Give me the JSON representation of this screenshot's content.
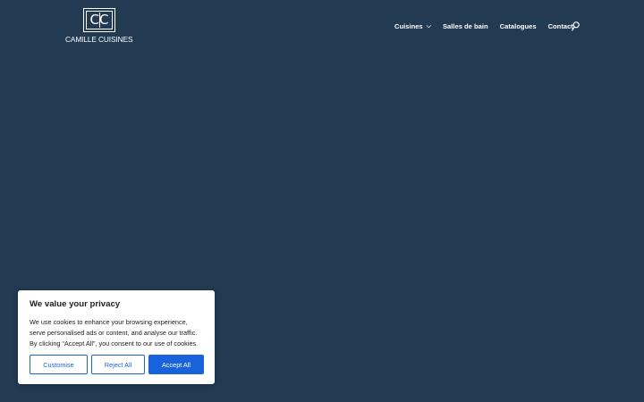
{
  "brand": {
    "name": "CAMILLE CUISINES",
    "monogram": "CC"
  },
  "nav": {
    "items": [
      {
        "label": "Cuisines",
        "has_dropdown": true
      },
      {
        "label": "Salles de bain"
      },
      {
        "label": "Catalogues"
      },
      {
        "label": "Contact"
      }
    ],
    "search_icon": "search-icon"
  },
  "cookie_banner": {
    "title": "We value your privacy",
    "body": "We use cookies to enhance your browsing experience, serve personalised ads or content, and analyse our traffic. By clicking “Accept All”, you consent to our use of cookies.",
    "buttons": {
      "customise": "Customise",
      "reject": "Reject All",
      "accept": "Accept All"
    }
  },
  "colors": {
    "background": "#223a52",
    "accent": "#1863dc",
    "banner_bg": "#ffffff"
  }
}
